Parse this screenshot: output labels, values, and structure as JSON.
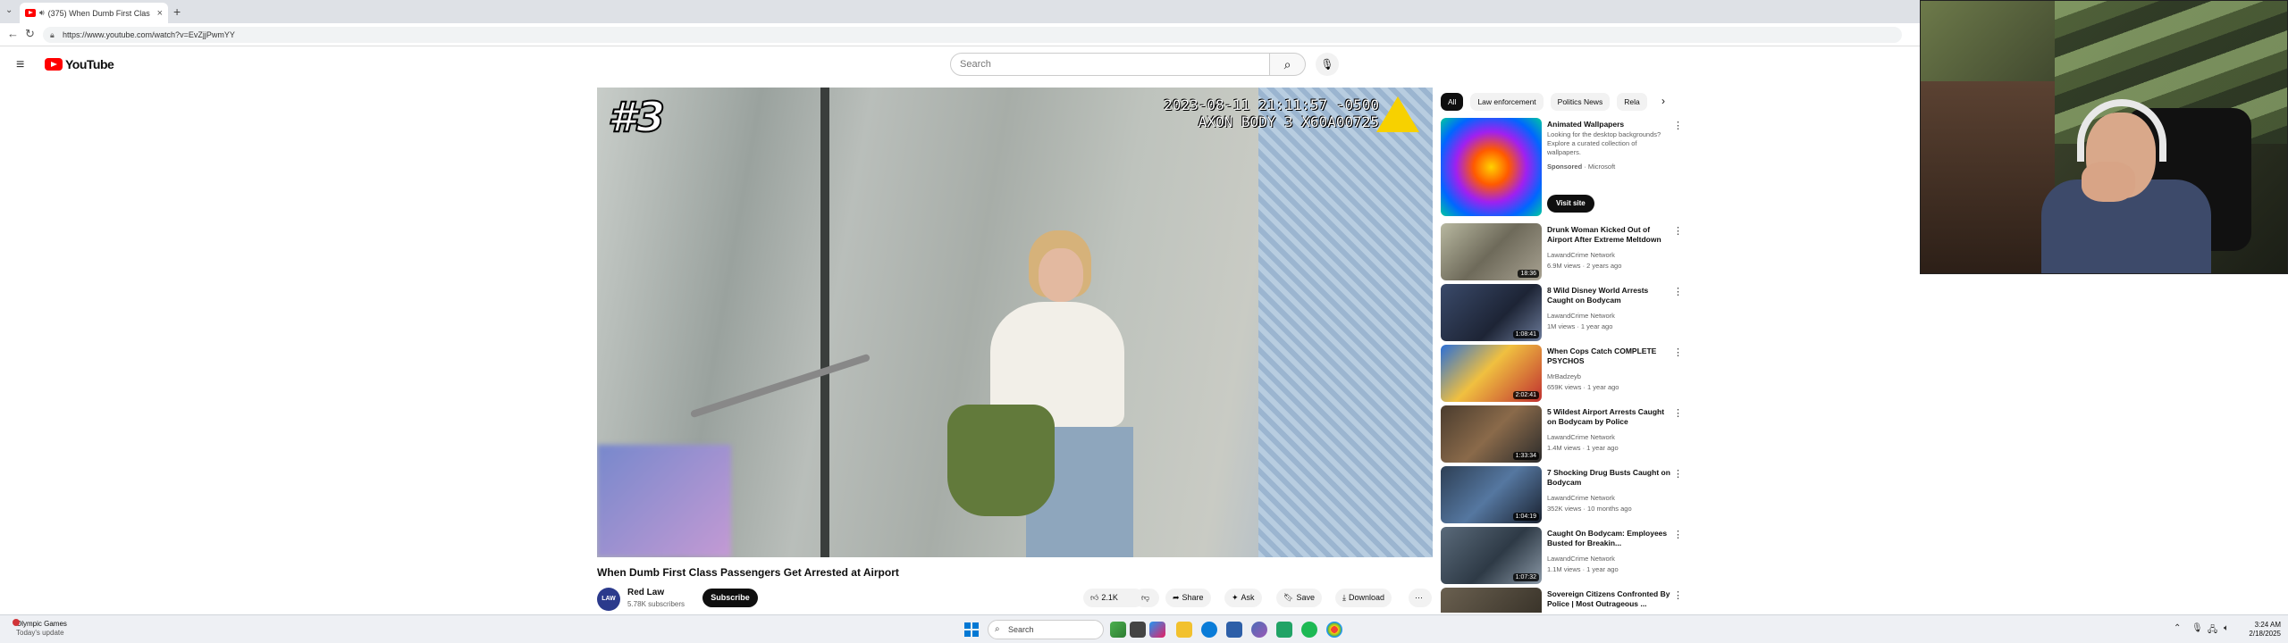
{
  "browser": {
    "tab_title": "(375) When Dumb First Clas",
    "new_tab_glyph": "+",
    "url": "https://www.youtube.com/watch?v=EvZjjPwmYY"
  },
  "youtube": {
    "logo_text": "YouTube",
    "search_placeholder": "Search"
  },
  "video": {
    "overlay_rank": "#3",
    "stamp_line1": "2023-08-11 21:11:57 -0500",
    "stamp_line2": "AXON BODY 3 X60A00725",
    "title": "When Dumb First Class Passengers Get Arrested at Airport",
    "channel": {
      "avatar_text": "LAW",
      "name": "Red Law",
      "subscribers": "5.78K subscribers",
      "subscribe_label": "Subscribe"
    },
    "actions": {
      "likes": "2.1K",
      "share": "Share",
      "ask": "Ask",
      "save": "Save",
      "download": "Download"
    }
  },
  "sidebar": {
    "chips": [
      "All",
      "Law enforcement",
      "Politics News",
      "Rela"
    ],
    "ad": {
      "title": "Animated Wallpapers",
      "description": "Looking for the desktop backgrounds? Explore a curated collection of wallpapers.",
      "sponsored": "Sponsored",
      "advertiser": "Microsoft",
      "button": "Visit site"
    },
    "recs": [
      {
        "title": "Drunk Woman Kicked Out of Airport After Extreme Meltdown",
        "channel": "LawandCrime Network",
        "meta": "6.9M views · 2 years ago",
        "duration": "18:36"
      },
      {
        "title": "8 Wild Disney World Arrests Caught on Bodycam",
        "channel": "LawandCrime Network",
        "meta": "1M views · 1 year ago",
        "duration": "1:08:41"
      },
      {
        "title": "When Cops Catch COMPLETE PSYCHOS",
        "channel": "MrBadzeyb",
        "meta": "659K views · 1 year ago",
        "duration": "2:02:41"
      },
      {
        "title": "5 Wildest Airport Arrests Caught on Bodycam by Police",
        "channel": "LawandCrime Network",
        "meta": "1.4M views · 1 year ago",
        "duration": "1:33:34"
      },
      {
        "title": "7 Shocking Drug Busts Caught on Bodycam",
        "channel": "LawandCrime Network",
        "meta": "352K views · 10 months ago",
        "duration": "1:04:19"
      },
      {
        "title": "Caught On Bodycam: Employees Busted for Breakin...",
        "channel": "LawandCrime Network",
        "meta": "1.1M views · 1 year ago",
        "duration": "1:07:32"
      },
      {
        "title": "Sovereign Citizens Confronted By Police | Most Outrageous ...",
        "channel": "",
        "meta": "",
        "duration": ""
      }
    ]
  },
  "taskbar": {
    "weather_title": "Olympic Games",
    "weather_sub": "Today's update",
    "search_label": "Search",
    "time": "3:24 AM",
    "date": "2/18/2025"
  },
  "icons": {
    "hamburger": "menu-icon",
    "search": "search-icon",
    "mic": "mic-icon",
    "like": "thumbs-up-icon",
    "dislike": "thumbs-down-icon",
    "share": "share-icon",
    "ask": "sparkle-icon",
    "save": "bookmark-icon",
    "download": "download-icon",
    "more": "more-vert-icon"
  },
  "colors": {
    "youtube_red": "#ff0000",
    "subscribe_bg": "#0f0f0f",
    "chip_bg": "#f2f2f2",
    "windows_blue": "#0078d4"
  }
}
